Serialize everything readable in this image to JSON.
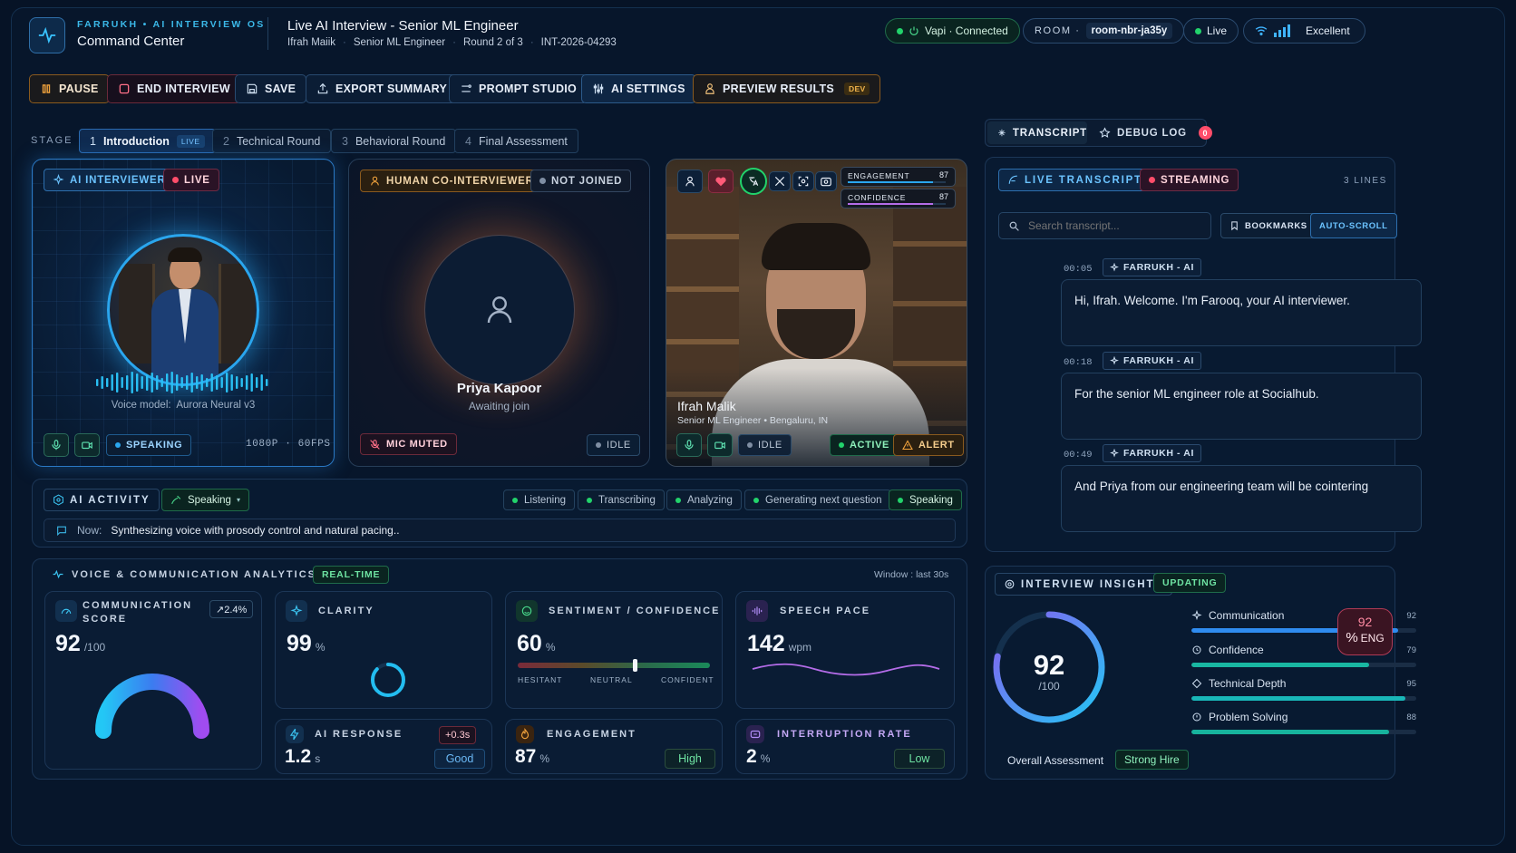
{
  "brand": {
    "eyebrow": "FARRUKH • AI INTERVIEW OS",
    "title": "Command Center"
  },
  "session": {
    "title": "Live AI Interview - Senior ML Engineer",
    "candidate": "Ifrah Maiik",
    "role": "Senior ML Engineer",
    "round": "Round 2 of 3",
    "id": "INT-2026-04293"
  },
  "status": {
    "vapi": "Vapi · Connected",
    "room_label": "ROOM ·",
    "room_id": "room-nbr-ja35y",
    "live": "Live",
    "network": "Excellent"
  },
  "toolbar": {
    "pause": "PAUSE",
    "end": "END INTERVIEW",
    "save": "SAVE",
    "export": "EXPORT SUMMARY",
    "prompt": "PROMPT STUDIO",
    "settings": "AI SETTINGS",
    "preview": "PREVIEW RESULTS",
    "preview_badge": "DEV"
  },
  "stage": {
    "label": "STAGE",
    "items": [
      {
        "num": "1",
        "label": "Introduction",
        "badge": "LIVE"
      },
      {
        "num": "2",
        "label": "Technical Round"
      },
      {
        "num": "3",
        "label": "Behavioral Round"
      },
      {
        "num": "4",
        "label": "Final Assessment"
      }
    ]
  },
  "ai_card": {
    "tag": "AI INTERVIEWER",
    "live": "LIVE",
    "voice_label": "Voice model:",
    "voice_model": "Aurora Neural v3",
    "state": "SPEAKING",
    "quality": "1080P · 60FPS"
  },
  "human_card": {
    "tag": "HUMAN CO-INTERVIEWER",
    "status": "NOT JOINED",
    "name": "Priya Kapoor",
    "substatus": "Awaiting join",
    "mic": "MIC MUTED",
    "state": "IDLE"
  },
  "candidate_card": {
    "engagement_label": "ENGAGEMENT",
    "engagement_value": "87",
    "confidence_label": "CONFIDENCE",
    "confidence_value": "87",
    "name": "Ifrah Malik",
    "detail": "Senior ML Engineer • Bengaluru, IN",
    "idle": "IDLE",
    "active": "ACTIVE",
    "alert": "ALERT"
  },
  "activity": {
    "title": "AI ACTIVITY",
    "mode": "Speaking",
    "states": [
      "Listening",
      "Transcribing",
      "Analyzing",
      "Generating next question",
      "Speaking"
    ],
    "now_label": "Now:",
    "now_text": "Synthesizing voice with prosody control and natural pacing.."
  },
  "analytics": {
    "title": "VOICE & COMMUNICATION ANALYTICS",
    "badge": "REAL-TIME",
    "window": "Window : last 30s",
    "comm": {
      "label1": "COMMUNICATION",
      "label2": "SCORE",
      "value": "92",
      "unit": "/100",
      "delta": "↗2.4%"
    },
    "clarity": {
      "label": "CLARITY",
      "value": "99",
      "unit": "%"
    },
    "sentiment": {
      "label": "SENTIMENT / CONFIDENCE",
      "value": "60",
      "unit": "%",
      "scale": [
        "HESITANT",
        "NEUTRAL",
        "CONFIDENT"
      ]
    },
    "pace": {
      "label": "SPEECH PACE",
      "value": "142",
      "unit": "wpm"
    },
    "response": {
      "label": "AI RESPONSE",
      "value": "1.2",
      "unit": "s",
      "delta": "+0.3s",
      "rating": "Good"
    },
    "engagement": {
      "label": "ENGAGEMENT",
      "value": "87",
      "unit": "%",
      "rating": "High"
    },
    "interruption": {
      "label": "INTERRUPTION RATE",
      "value": "2",
      "unit": "%",
      "rating": "Low"
    }
  },
  "transcript": {
    "tab1": "TRANSCRIPT",
    "tab2": "DEBUG LOG",
    "debug_count": "0",
    "title": "LIVE TRANSCRIPT",
    "streaming": "STREAMING",
    "lines_count": "3 LINES",
    "search_placeholder": "Search transcript...",
    "bookmarks": "BOOKMARKS",
    "autoscroll": "AUTO-SCROLL",
    "entries": [
      {
        "time": "00:05",
        "speaker": "FARRUKH - AI",
        "text": "Hi, Ifrah. Welcome. I'm Farooq, your AI interviewer."
      },
      {
        "time": "00:18",
        "speaker": "FARRUKH - AI",
        "text": "For the senior ML engineer role at Socialhub."
      },
      {
        "time": "00:49",
        "speaker": "FARRUKH - AI",
        "text": "And Priya from our engineering team will be cointering"
      }
    ]
  },
  "insights": {
    "title": "INTERVIEW INSIGHTS",
    "status": "UPDATING",
    "score": "92",
    "score_unit": "/100",
    "score_fraction": 0.92,
    "overall_label": "Overall Assessment",
    "overall_value": "Strong Hire",
    "eng_value": "92",
    "eng_label": "ENG",
    "rows": [
      {
        "label": "Communication",
        "value": "92",
        "pct": 92,
        "color": "#2f8cf0"
      },
      {
        "label": "Confidence",
        "value": "79",
        "pct": 79,
        "color": "#19b7a2"
      },
      {
        "label": "Technical Depth",
        "value": "95",
        "pct": 95,
        "color": "#19b7b8"
      },
      {
        "label": "Problem Solving",
        "value": "88",
        "pct": 88,
        "color": "#17b39d"
      }
    ]
  },
  "colors": {
    "accent": "#2ec6f0",
    "live": "#ff4d6a",
    "ok": "#22d36b",
    "warn": "#f0a23c"
  }
}
